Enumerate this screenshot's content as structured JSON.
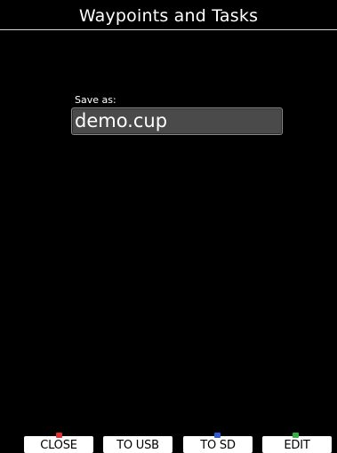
{
  "window": {
    "title": "Waypoints and Tasks"
  },
  "form": {
    "save_label": "Save as:",
    "filename_value": "demo.cup"
  },
  "softkeys": [
    {
      "label": "CLOSE",
      "led": "red-led-icon",
      "led_color": "#e03030"
    },
    {
      "label": "TO USB",
      "led": null,
      "led_color": null
    },
    {
      "label": "TO SD",
      "led": "blue-led-icon",
      "led_color": "#2a5bd7"
    },
    {
      "label": "EDIT",
      "led": "green-led-icon",
      "led_color": "#32b040"
    }
  ],
  "colors": {
    "background": "#000000",
    "input_fill": "#4a4a4a",
    "softkey_fill": "#ffffff"
  }
}
